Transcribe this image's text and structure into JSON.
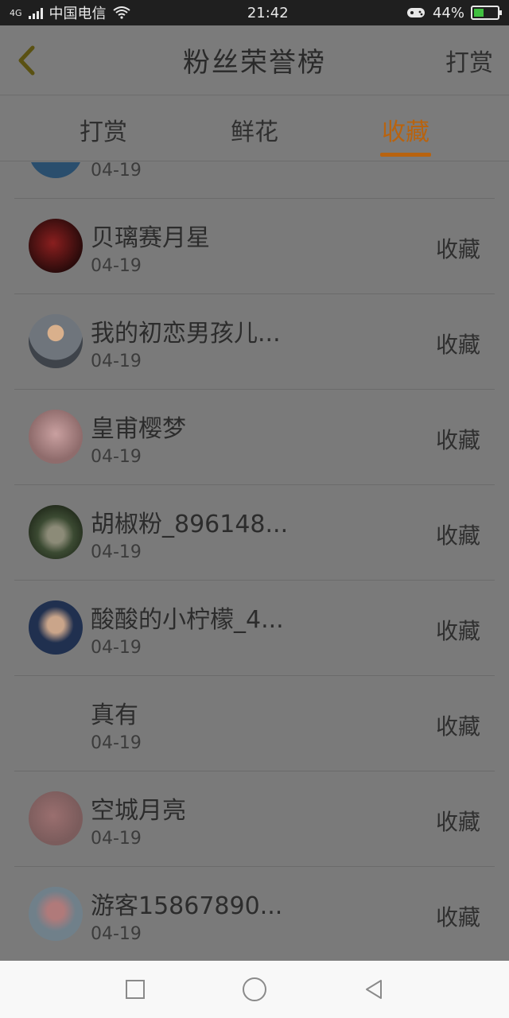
{
  "status_bar": {
    "carrier": "中国电信",
    "network": "4G",
    "time": "21:42",
    "battery": "44%"
  },
  "header": {
    "title": "粉丝荣誉榜",
    "action": "打赏"
  },
  "tabs": [
    {
      "label": "打赏"
    },
    {
      "label": "鲜花"
    },
    {
      "label": "收藏"
    }
  ],
  "list": [
    {
      "name": "",
      "date": "04-19",
      "action": "",
      "avatar_color": "#2a4e6d"
    },
    {
      "name": "贝璃赛月星",
      "date": "04-19",
      "action": "收藏",
      "avatar_color": "#4a1414"
    },
    {
      "name": "我的初恋男孩儿...",
      "date": "04-19",
      "action": "收藏",
      "avatar_color": "#6f757c"
    },
    {
      "name": "皇甫樱梦",
      "date": "04-19",
      "action": "收藏",
      "avatar_color": "#8f6c6c"
    },
    {
      "name": "胡椒粉_896148...",
      "date": "04-19",
      "action": "收藏",
      "avatar_color": "#3b4a32"
    },
    {
      "name": "酸酸的小柠檬_4...",
      "date": "04-19",
      "action": "收藏",
      "avatar_color": "#20304f"
    },
    {
      "name": "真有",
      "date": "04-19",
      "action": "收藏",
      "avatar_color": ""
    },
    {
      "name": "空城月亮",
      "date": "04-19",
      "action": "收藏",
      "avatar_color": "#7b5c5c"
    },
    {
      "name": "游客15867890...",
      "date": "04-19",
      "action": "收藏",
      "avatar_color": "#70808a"
    }
  ]
}
